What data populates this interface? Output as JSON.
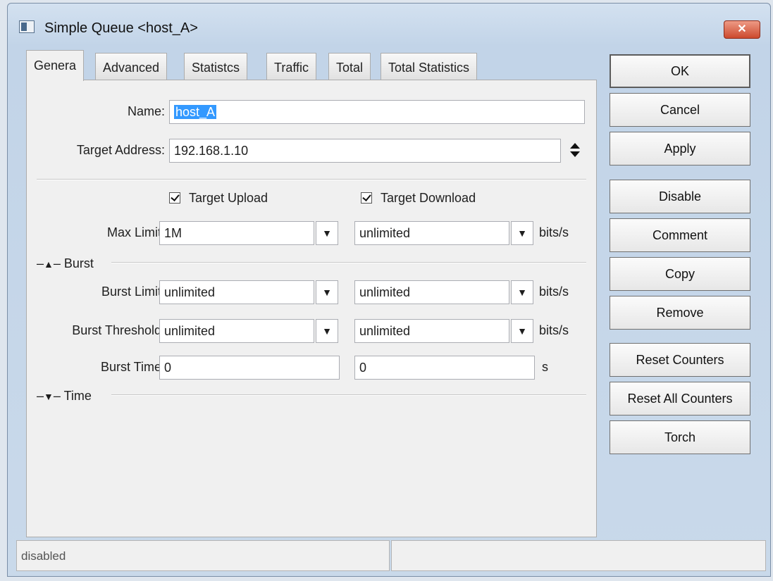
{
  "window": {
    "title": "Simple Queue <host_A>",
    "close_symbol": "✕"
  },
  "tabs": [
    "Genera",
    "Advanced",
    "Statistcs",
    "Traffic",
    "Total",
    "Total Statistics"
  ],
  "general": {
    "name_label": "Name:",
    "name_value": "host_A",
    "target_address_label": "Target Address:",
    "target_address_value": "192.168.1.10",
    "target_upload_label": "Target Upload",
    "target_upload_checked": true,
    "target_download_label": "Target Download",
    "target_download_checked": true,
    "max_limit_label": "Max Limit:",
    "max_limit_upload": "1M",
    "max_limit_download": "unlimited",
    "unit_bits": "bits/s",
    "burst_section": "Burst",
    "burst_limit_label": "Burst Limit:",
    "burst_limit_upload": "unlimited",
    "burst_limit_download": "unlimited",
    "burst_threshold_label": "Burst Threshold:",
    "burst_threshold_upload": "unlimited",
    "burst_threshold_download": "unlimited",
    "burst_time_label": "Burst Time:",
    "burst_time_upload": "0",
    "burst_time_download": "0",
    "unit_seconds": "s",
    "time_section": "Time"
  },
  "buttons": {
    "ok": "OK",
    "cancel": "Cancel",
    "apply": "Apply",
    "disable": "Disable",
    "comment": "Comment",
    "copy": "Copy",
    "remove": "Remove",
    "reset_counters": "Reset Counters",
    "reset_all_counters": "Reset All Counters",
    "torch": "Torch"
  },
  "icons": {
    "dropdown": "▼",
    "expanded": "▲",
    "collapsed": "▼",
    "spinner": "updown-arrows-icon"
  },
  "status": {
    "left": "disabled",
    "right": ""
  }
}
